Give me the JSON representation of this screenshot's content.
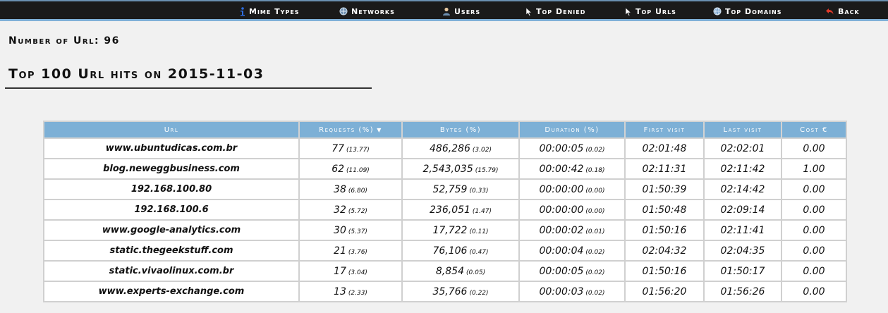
{
  "nav": {
    "items": [
      {
        "label": "Mime Types",
        "icon": "info-icon"
      },
      {
        "label": "Networks",
        "icon": "network-icon"
      },
      {
        "label": "Users",
        "icon": "user-icon"
      },
      {
        "label": "Top Denied",
        "icon": "cursor-icon"
      },
      {
        "label": "Top Urls",
        "icon": "cursor-icon"
      },
      {
        "label": "Top Domains",
        "icon": "globe-icon"
      },
      {
        "label": "Back",
        "icon": "back-arrow-icon"
      }
    ]
  },
  "summary": {
    "label": "Number of Url: 96"
  },
  "page": {
    "title": "Top 100 Url hits on 2015-11-03"
  },
  "table": {
    "columns": [
      "Url",
      "Requests (%)",
      "Bytes (%)",
      "Duration (%)",
      "First visit",
      "Last visit",
      "Cost €"
    ],
    "sort_indicator": "▼",
    "rows": [
      {
        "url": "www.ubuntudicas.com.br",
        "requests": "77",
        "requests_pct": "(13.77)",
        "bytes": "486,286",
        "bytes_pct": "(3.02)",
        "duration": "00:00:05",
        "duration_pct": "(0.02)",
        "first": "02:01:48",
        "last": "02:02:01",
        "cost": "0.00"
      },
      {
        "url": "blog.neweggbusiness.com",
        "requests": "62",
        "requests_pct": "(11.09)",
        "bytes": "2,543,035",
        "bytes_pct": "(15.79)",
        "duration": "00:00:42",
        "duration_pct": "(0.18)",
        "first": "02:11:31",
        "last": "02:11:42",
        "cost": "1.00"
      },
      {
        "url": "192.168.100.80",
        "requests": "38",
        "requests_pct": "(6.80)",
        "bytes": "52,759",
        "bytes_pct": "(0.33)",
        "duration": "00:00:00",
        "duration_pct": "(0.00)",
        "first": "01:50:39",
        "last": "02:14:42",
        "cost": "0.00"
      },
      {
        "url": "192.168.100.6",
        "requests": "32",
        "requests_pct": "(5.72)",
        "bytes": "236,051",
        "bytes_pct": "(1.47)",
        "duration": "00:00:00",
        "duration_pct": "(0.00)",
        "first": "01:50:48",
        "last": "02:09:14",
        "cost": "0.00"
      },
      {
        "url": "www.google-analytics.com",
        "requests": "30",
        "requests_pct": "(5.37)",
        "bytes": "17,722",
        "bytes_pct": "(0.11)",
        "duration": "00:00:02",
        "duration_pct": "(0.01)",
        "first": "01:50:16",
        "last": "02:11:41",
        "cost": "0.00"
      },
      {
        "url": "static.thegeekstuff.com",
        "requests": "21",
        "requests_pct": "(3.76)",
        "bytes": "76,106",
        "bytes_pct": "(0.47)",
        "duration": "00:00:04",
        "duration_pct": "(0.02)",
        "first": "02:04:32",
        "last": "02:04:35",
        "cost": "0.00"
      },
      {
        "url": "static.vivaolinux.com.br",
        "requests": "17",
        "requests_pct": "(3.04)",
        "bytes": "8,854",
        "bytes_pct": "(0.05)",
        "duration": "00:00:05",
        "duration_pct": "(0.02)",
        "first": "01:50:16",
        "last": "01:50:17",
        "cost": "0.00"
      },
      {
        "url": "www.experts-exchange.com",
        "requests": "13",
        "requests_pct": "(2.33)",
        "bytes": "35,766",
        "bytes_pct": "(0.22)",
        "duration": "00:00:03",
        "duration_pct": "(0.02)",
        "first": "01:56:20",
        "last": "01:56:26",
        "cost": "0.00"
      }
    ]
  }
}
